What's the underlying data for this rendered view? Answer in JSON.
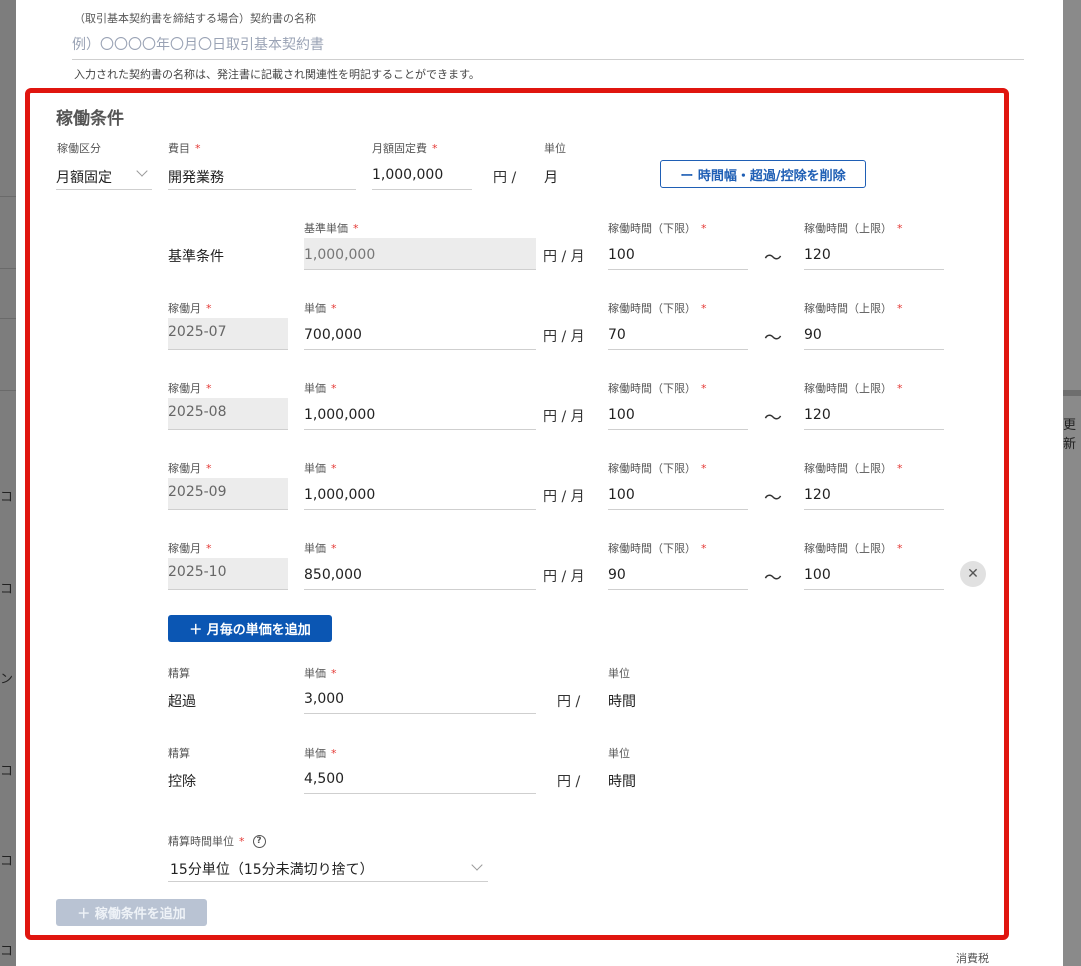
{
  "background": {
    "left_fragments": [
      "コ",
      "コ",
      "ン",
      "コ",
      "コ",
      "コ"
    ],
    "right_fragment": "更新"
  },
  "contract_name": {
    "label": "（取引基本契約書を締結する場合）契約書の名称",
    "placeholder": "例）〇〇〇〇年〇月〇日取引基本契約書",
    "help": "入力された契約書の名称は、発注書に記載され関連性を明記することができます。"
  },
  "conditions": {
    "title": "稼働条件",
    "category_label": "稼働区分",
    "category_value": "月額固定",
    "expense_label": "費目",
    "expense_value": "開発業務",
    "fixed_fee_label": "月額固定費",
    "fixed_fee_value": "1,000,000",
    "fixed_fee_unit": "円 /",
    "unit_label": "単位",
    "unit_value": "月",
    "remove_range_button": "ー 時間幅・超過/控除を削除",
    "base": {
      "row_label": "基準条件",
      "price_label": "基準単価",
      "price_value": "1,000,000",
      "unit": "円 / 月",
      "lower_label": "稼働時間（下限）",
      "lower_value": "100",
      "tilde": "〜",
      "upper_label": "稼働時間（上限）",
      "upper_value": "120"
    },
    "month_label": "稼働月",
    "price_label": "単価",
    "row_unit": "円 / 月",
    "lower_label": "稼働時間（下限）",
    "upper_label": "稼働時間（上限）",
    "tilde": "〜",
    "monthly": [
      {
        "month": "2025-07",
        "price": "700,000",
        "lower": "70",
        "upper": "90"
      },
      {
        "month": "2025-08",
        "price": "1,000,000",
        "lower": "100",
        "upper": "120"
      },
      {
        "month": "2025-09",
        "price": "1,000,000",
        "lower": "100",
        "upper": "120"
      },
      {
        "month": "2025-10",
        "price": "850,000",
        "lower": "90",
        "upper": "100"
      }
    ],
    "remove_month_icon": "close-icon",
    "add_monthly_button": "＋ 月毎の単価を追加",
    "settlement": [
      {
        "label": "精算",
        "type": "超過",
        "price_label": "単価",
        "price": "3,000",
        "unit": "円 /",
        "unit_label": "単位",
        "unit_value": "時間"
      },
      {
        "label": "精算",
        "type": "控除",
        "price_label": "単価",
        "price": "4,500",
        "unit": "円 /",
        "unit_label": "単位",
        "unit_value": "時間"
      }
    ],
    "rounding_label": "精算時間単位",
    "rounding_value": "15分単位（15分未満切り捨て）",
    "add_condition_button": "＋ 稼働条件を追加"
  },
  "tax_label": "消費税",
  "colors": {
    "highlight": "#e0150f",
    "primary": "#0b56b3",
    "required": "#e53935"
  }
}
